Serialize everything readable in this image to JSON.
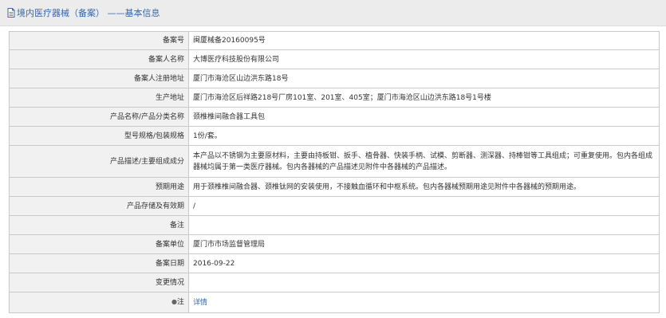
{
  "header": {
    "title": "境内医疗器械（备案） ——基本信息",
    "icon": "document-icon"
  },
  "rows": [
    {
      "label": "备案号",
      "value": "闽厦械备20160095号"
    },
    {
      "label": "备案人名称",
      "value": "大博医疗科技股份有限公司"
    },
    {
      "label": "备案人注册地址",
      "value": "厦门市海沧区山边洪东路18号"
    },
    {
      "label": "生产地址",
      "value": "厦门市海沧区后祥路218号厂房101室、201室、405室；厦门市海沧区山边洪东路18号1号楼"
    },
    {
      "label": "产品名称/产品分类名称",
      "value": "颈椎椎间融合器工具包"
    },
    {
      "label": "型号规格/包装规格",
      "value": "1份/套。"
    },
    {
      "label": "产品描述/主要组成成分",
      "value": "本产品以不锈钢为主要原材料，主要由持板钳、扳手、植骨器、快装手柄、试模、剪断器、测深器、持棒钳等工具组成；可重复使用。包内各组成器械均属于第一类医疗器械。包内各器械的产品描述见附件中各器械的产品描述。"
    },
    {
      "label": "预期用途",
      "value": "用于颈椎椎间融合器、颈椎钛网的安装使用，不接触血循环和中枢系统。包内各器械预期用途见附件中各器械的预期用途。"
    },
    {
      "label": "产品存储及有效期",
      "value": "/"
    },
    {
      "label": "备注",
      "value": ""
    },
    {
      "label": "备案单位",
      "value": "厦门市市场监督管理局"
    },
    {
      "label": "备案日期",
      "value": "2016-09-22"
    },
    {
      "label": "变更情况",
      "value": ""
    },
    {
      "label": "注",
      "icon": "bullet-dot-icon",
      "value": "详情"
    }
  ]
}
